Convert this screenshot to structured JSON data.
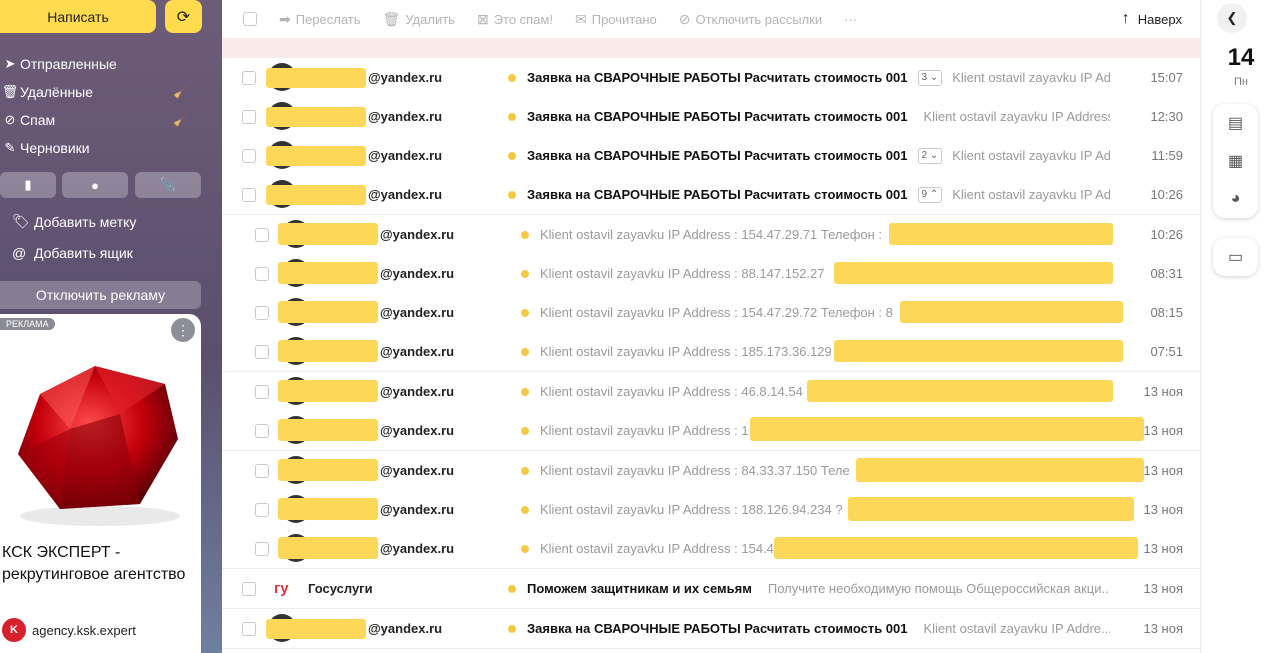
{
  "sidebar": {
    "compose_label": "Написать",
    "folders": [
      {
        "label": "Отправленные",
        "icon": "send-icon"
      },
      {
        "label": "Удалённые",
        "icon": "trash-icon"
      },
      {
        "label": "Спам",
        "icon": "spam-icon"
      },
      {
        "label": "Черновики",
        "icon": "draft-icon"
      }
    ],
    "add_label": "Добавить метку",
    "add_box": "Добавить ящик",
    "disable_ads": "Отключить рекламу"
  },
  "ad": {
    "label": "РЕКЛАМА",
    "title": "КСК ЭКСПЕРТ - рекрутинговое агентство",
    "site": "agency.ksk.expert"
  },
  "toolbar": {
    "forward": "Переслать",
    "delete": "Удалить",
    "spam": "Это спам!",
    "read": "Прочитано",
    "unsubscribe": "Отключить рассылки",
    "more": "···",
    "top": "Наверх"
  },
  "messages": [
    {
      "sender": "@yandex.ru",
      "subject": "Заявка на СВАРОЧНЫЕ РАБОТЫ Расчитать стоимость 001",
      "count": "3",
      "snippet": "Klient ostavil zayavku IP Address",
      "time": "15:07"
    },
    {
      "sender": "@yandex.ru",
      "subject": "Заявка на СВАРОЧНЫЕ РАБОТЫ Расчитать стоимость 001",
      "count": "",
      "snippet": "Klient ostavil zayavku IP Address",
      "time": "12:30"
    },
    {
      "sender": "@yandex.ru",
      "subject": "Заявка на СВАРОЧНЫЕ РАБОТЫ Расчитать стоимость 001",
      "count": "2",
      "snippet": "Klient ostavil zayavku IP Address",
      "time": "11:59"
    },
    {
      "sender": "@yandex.ru",
      "subject": "Заявка на СВАРОЧНЫЕ РАБОТЫ Расчитать стоимость 001",
      "count": "9",
      "snippet": "Klient ostavil zayavku IP Address",
      "time": "10:26"
    }
  ],
  "thread": [
    {
      "sender": "@yandex.ru",
      "snippet": "Klient ostavil zayavku IP Address : 154.47.29.71 Телефон :",
      "time": "10:26"
    },
    {
      "sender": "@yandex.ru",
      "snippet": "Klient ostavil zayavku IP Address : 88.147.152.27",
      "time": "08:31"
    },
    {
      "sender": "@yandex.ru",
      "snippet": "Klient ostavil zayavku IP Address : 154.47.29.72 Телефон : 8",
      "time": "08:15"
    },
    {
      "sender": "@yandex.ru",
      "snippet": "Klient ostavil zayavku IP Address : 185.173.36.129",
      "time": "07:51"
    },
    {
      "sender": "@yandex.ru",
      "snippet": "Klient ostavil zayavku IP Address : 46.8.14.54",
      "time": "13 ноя"
    },
    {
      "sender": "@yandex.ru",
      "snippet": "Klient ostavil zayavku IP Address : 1",
      "time": "13 ноя"
    },
    {
      "sender": "@yandex.ru",
      "snippet": "Klient ostavil zayavku IP Address : 84.33.37.150 Теле",
      "time": "13 ноя"
    },
    {
      "sender": "@yandex.ru",
      "snippet": "Klient ostavil zayavku IP Address : 188.126.94.234 ?",
      "time": "13 ноя"
    },
    {
      "sender": "@yandex.ru",
      "snippet": "Klient ostavil zayavku IP Address : 154.4",
      "time": "13 ноя"
    }
  ],
  "after": [
    {
      "sender": "Госуслуги",
      "logo": "гу",
      "subject": "Поможем защитникам и их семьям",
      "snippet": "Получите необходимую помощь Общероссийская акци...",
      "time": "13 ноя"
    },
    {
      "sender": "@yandex.ru",
      "subject": "Заявка на СВАРОЧНЫЕ РАБОТЫ Расчитать стоимость 001",
      "snippet": "Klient ostavil zayavku IP Addre...",
      "time": "13 ноя"
    }
  ],
  "calendar": {
    "day": "14",
    "weekday": "Пн"
  },
  "colors": {
    "accent": "#ffdb4d",
    "mask": "#fcd758"
  }
}
